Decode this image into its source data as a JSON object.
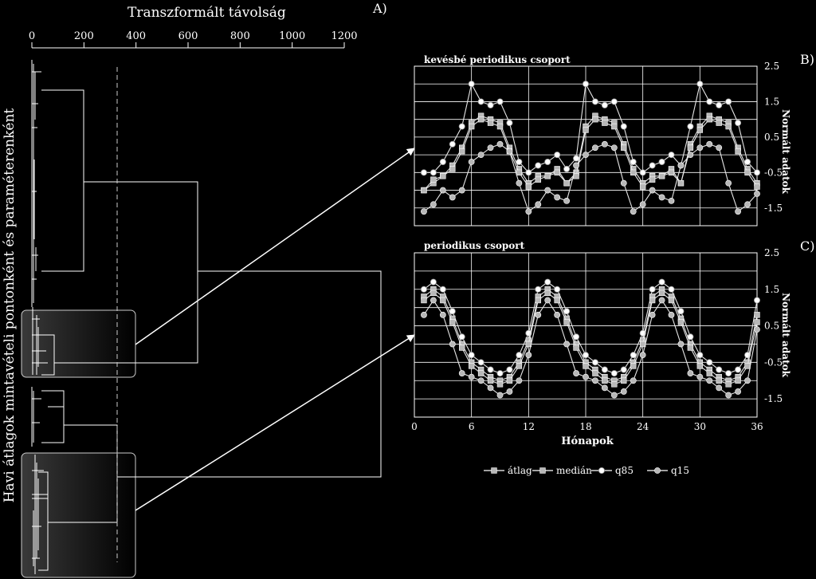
{
  "panel_labels": {
    "a": "A)",
    "b": "B)",
    "c": "C)"
  },
  "dendrogram": {
    "title": "Transzformált távolság",
    "ylabel": "Havi átlagok mintavételi pontonként és paraméterenként",
    "axis_ticks": [
      "0",
      "200",
      "400",
      "600",
      "800",
      "1000",
      "1200"
    ],
    "axis_values": [
      0,
      200,
      400,
      600,
      800,
      1000,
      1200
    ],
    "cut_distance": 330,
    "merges": [
      {
        "name": "upper-block",
        "distance": 200
      },
      {
        "name": "highlighted-group-1",
        "distance": 70
      },
      {
        "name": "group-1-join",
        "distance": 640
      },
      {
        "name": "middle-block",
        "distance": 130
      },
      {
        "name": "highlighted-group-2",
        "distance": 60
      },
      {
        "name": "group-2-join",
        "distance": 330
      }
    ]
  },
  "chart_data": [
    {
      "type": "line",
      "title": "kevésbé periodikus csoport",
      "xlabel": "",
      "ylabel": "Normált adatok",
      "xlim": [
        0,
        36
      ],
      "ylim": [
        -2,
        2.5
      ],
      "y_ticks": [
        2.5,
        1.5,
        0.5,
        -0.5,
        -1.5
      ],
      "y_tick_labels": [
        "2.5",
        "1.5",
        "0.5",
        "-0.5",
        "-1.5"
      ],
      "x": [
        1,
        2,
        3,
        4,
        5,
        6,
        7,
        8,
        9,
        10,
        11,
        12,
        13,
        14,
        15,
        16,
        17,
        18,
        19,
        20,
        21,
        22,
        23,
        24,
        25,
        26,
        27,
        28,
        29,
        30,
        31,
        32,
        33,
        34,
        35,
        36
      ],
      "series": [
        {
          "name": "q85",
          "values": [
            -0.5,
            -0.5,
            -0.2,
            0.3,
            0.8,
            2.0,
            1.5,
            1.4,
            1.5,
            0.9,
            -0.2,
            -0.5,
            -0.3,
            -0.2,
            0.0,
            -0.4,
            -0.1,
            2.0,
            1.5,
            1.4,
            1.5,
            0.8,
            -0.2,
            -0.5,
            -0.3,
            -0.2,
            0.0,
            -0.3,
            0.8,
            2.0,
            1.5,
            1.4,
            1.5,
            0.9,
            -0.2,
            -0.5
          ]
        },
        {
          "name": "átlag",
          "values": [
            -1.0,
            -0.8,
            -0.6,
            -0.3,
            0.2,
            0.9,
            1.1,
            1.0,
            0.9,
            0.2,
            -0.4,
            -0.8,
            -0.6,
            -0.6,
            -0.4,
            -0.8,
            -0.5,
            0.8,
            1.1,
            1.0,
            0.9,
            0.3,
            -0.4,
            -0.8,
            -0.6,
            -0.6,
            -0.4,
            -0.8,
            0.3,
            0.8,
            1.1,
            1.0,
            0.9,
            0.2,
            -0.4,
            -0.8
          ]
        },
        {
          "name": "medián",
          "values": [
            -1.0,
            -0.7,
            -0.6,
            -0.4,
            0.1,
            0.8,
            1.0,
            0.9,
            0.8,
            0.1,
            -0.5,
            -0.9,
            -0.7,
            -0.6,
            -0.5,
            -0.8,
            -0.6,
            0.7,
            1.0,
            0.9,
            0.8,
            0.2,
            -0.5,
            -0.9,
            -0.7,
            -0.6,
            -0.5,
            -0.8,
            0.2,
            0.7,
            1.0,
            0.9,
            0.8,
            0.1,
            -0.5,
            -0.9
          ]
        },
        {
          "name": "q15",
          "values": [
            -1.6,
            -1.4,
            -1.0,
            -1.2,
            -1.0,
            -0.2,
            0.0,
            0.2,
            0.3,
            0.1,
            -0.8,
            -1.6,
            -1.4,
            -1.0,
            -1.2,
            -1.3,
            -0.3,
            0.0,
            0.2,
            0.3,
            0.2,
            -0.8,
            -1.6,
            -1.4,
            -1.0,
            -1.2,
            -1.3,
            -0.3,
            0.0,
            0.2,
            0.3,
            0.2,
            -0.8,
            -1.6,
            -1.4,
            -1.1
          ]
        }
      ]
    },
    {
      "type": "line",
      "title": "periodikus csoport",
      "xlabel": "Hónapok",
      "ylabel": "Normált adatok",
      "xlim": [
        0,
        36
      ],
      "ylim": [
        -2,
        2.5
      ],
      "x_ticks": [
        0,
        6,
        12,
        18,
        24,
        30,
        36
      ],
      "x_tick_labels": [
        "0",
        "6",
        "12",
        "18",
        "24",
        "30",
        "36"
      ],
      "y_ticks": [
        2.5,
        1.5,
        0.5,
        -0.5,
        -1.5
      ],
      "y_tick_labels": [
        "2.5",
        "1.5",
        "0.5",
        "-0.5",
        "-1.5"
      ],
      "x": [
        1,
        2,
        3,
        4,
        5,
        6,
        7,
        8,
        9,
        10,
        11,
        12,
        13,
        14,
        15,
        16,
        17,
        18,
        19,
        20,
        21,
        22,
        23,
        24,
        25,
        26,
        27,
        28,
        29,
        30,
        31,
        32,
        33,
        34,
        35,
        36
      ],
      "series": [
        {
          "name": "q85",
          "values": [
            1.5,
            1.7,
            1.5,
            0.9,
            0.2,
            -0.3,
            -0.5,
            -0.7,
            -0.8,
            -0.7,
            -0.3,
            0.3,
            1.5,
            1.7,
            1.5,
            0.9,
            0.2,
            -0.3,
            -0.5,
            -0.7,
            -0.8,
            -0.7,
            -0.3,
            0.3,
            1.5,
            1.7,
            1.5,
            0.9,
            0.2,
            -0.3,
            -0.5,
            -0.7,
            -0.8,
            -0.7,
            -0.3,
            1.2
          ]
        },
        {
          "name": "átlag",
          "values": [
            1.3,
            1.5,
            1.3,
            0.7,
            0.0,
            -0.5,
            -0.7,
            -0.9,
            -1.0,
            -0.9,
            -0.5,
            0.1,
            1.3,
            1.5,
            1.3,
            0.7,
            0.0,
            -0.5,
            -0.7,
            -0.9,
            -1.0,
            -0.9,
            -0.5,
            0.1,
            1.3,
            1.5,
            1.3,
            0.7,
            0.0,
            -0.5,
            -0.7,
            -0.9,
            -1.0,
            -0.9,
            -0.5,
            0.8
          ]
        },
        {
          "name": "medián",
          "values": [
            1.2,
            1.4,
            1.2,
            0.6,
            -0.1,
            -0.6,
            -0.8,
            -1.0,
            -1.1,
            -1.0,
            -0.6,
            0.0,
            1.2,
            1.4,
            1.2,
            0.6,
            -0.1,
            -0.6,
            -0.8,
            -1.0,
            -1.1,
            -1.0,
            -0.6,
            0.0,
            1.2,
            1.4,
            1.2,
            0.6,
            -0.1,
            -0.6,
            -0.8,
            -1.0,
            -1.1,
            -1.0,
            -0.6,
            0.6
          ]
        },
        {
          "name": "q15",
          "values": [
            0.8,
            1.2,
            0.8,
            0.0,
            -0.8,
            -0.9,
            -1.0,
            -1.2,
            -1.4,
            -1.3,
            -1.0,
            -0.3,
            0.8,
            1.2,
            0.8,
            0.0,
            -0.8,
            -0.9,
            -1.0,
            -1.2,
            -1.4,
            -1.3,
            -1.0,
            -0.3,
            0.8,
            1.2,
            0.8,
            0.0,
            -0.8,
            -0.9,
            -1.0,
            -1.2,
            -1.4,
            -1.3,
            -1.0,
            0.4
          ]
        }
      ]
    }
  ],
  "legend": [
    {
      "label": "átlag",
      "marker": "square-gray"
    },
    {
      "label": "medián",
      "marker": "square-gray"
    },
    {
      "label": "q85",
      "marker": "circle-white"
    },
    {
      "label": "q15",
      "marker": "circle-gray"
    }
  ],
  "colors": {
    "background": "#000000",
    "foreground": "#ffffff",
    "marker": "#b8b8b8",
    "grid": "#ffffff"
  }
}
